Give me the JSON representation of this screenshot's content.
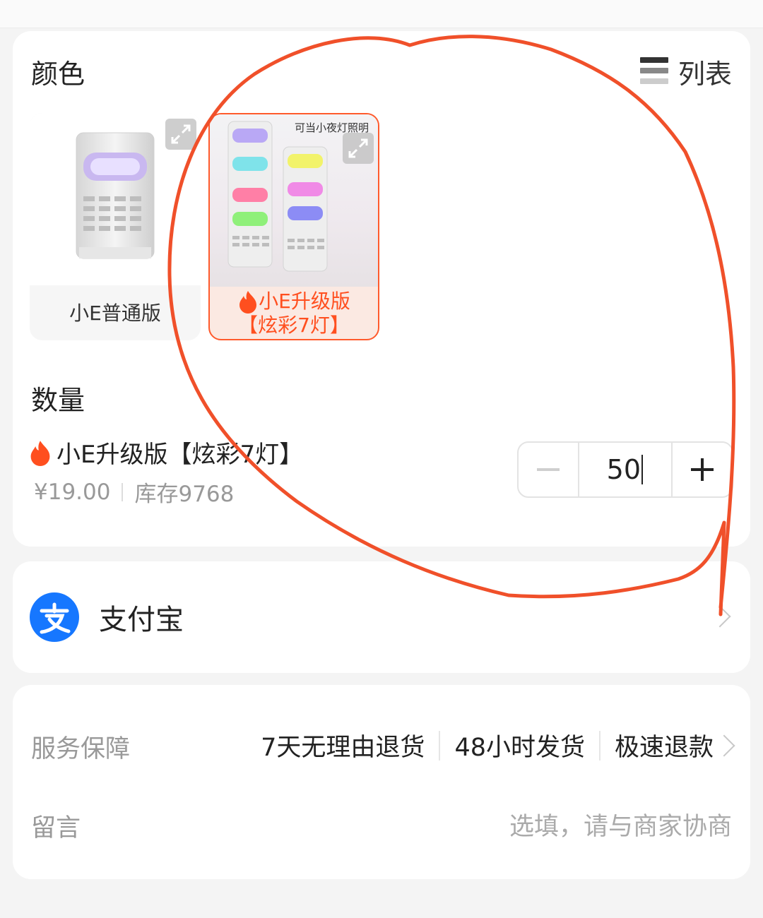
{
  "colors": {
    "accent": "#ff4f1f",
    "annotation_stroke": "#f0502a",
    "alipay_blue": "#1677ff"
  },
  "color_section": {
    "title": "颜色",
    "view_toggle_label": "列表",
    "variants": [
      {
        "name": "小E普通版",
        "selected": false
      },
      {
        "name_line1": "小E升级版",
        "name_line2": "【炫彩7灯】",
        "selected": true,
        "image_tag": "可当小夜灯照明"
      }
    ]
  },
  "quantity_section": {
    "title": "数量",
    "product_name": "小E升级版【炫彩7灯】",
    "price": "¥19.00",
    "stock": "库存9768",
    "quantity": "50"
  },
  "payment": {
    "method": "支付宝",
    "icon": "alipay-icon"
  },
  "service": {
    "label": "服务保障",
    "items": [
      "7天无理由退货",
      "48小时发货",
      "极速退款"
    ],
    "note_label": "留言",
    "note_placeholder": "选填，请与商家协商"
  }
}
